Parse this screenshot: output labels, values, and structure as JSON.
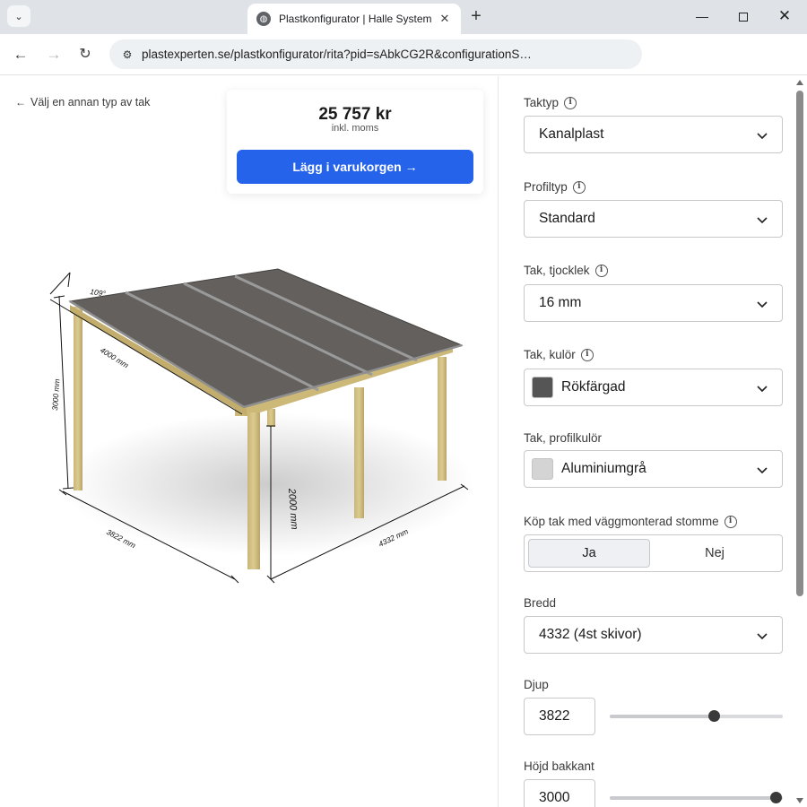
{
  "browser": {
    "tab_title": "Plastkonfigurator | Halle System",
    "url": "plastexperten.se/plastkonfigurator/rita?pid=sAbkCG2R&configurationS…",
    "tab_search_icon": "chevron-down-icon",
    "favicon": "globe-icon"
  },
  "page": {
    "back_link": "Välj en annan typ av tak",
    "price": "25 757 kr",
    "price_sub": "inkl. moms",
    "cart_button": "Lägg i varukorgen",
    "accent_color": "#2563eb"
  },
  "drawing": {
    "angle": "109°",
    "length_top": "4000 mm",
    "height_back": "3000 mm",
    "height_front": "2000 mm",
    "depth": "3822 mm",
    "width": "4332 mm"
  },
  "config": {
    "taktyp": {
      "label": "Taktyp",
      "value": "Kanalplast"
    },
    "profiltyp": {
      "label": "Profiltyp",
      "value": "Standard"
    },
    "tjocklek": {
      "label": "Tak, tjocklek",
      "value": "16 mm"
    },
    "kulor": {
      "label": "Tak, kulör",
      "value": "Rökfärgad",
      "swatch": "#555555"
    },
    "profilkulor": {
      "label": "Tak, profilkulör",
      "value": "Aluminiumgrå",
      "swatch": "#d4d4d4"
    },
    "stomme": {
      "label": "Köp tak med väggmonterad stomme",
      "options": [
        "Ja",
        "Nej"
      ],
      "selected": "Ja"
    },
    "bredd": {
      "label": "Bredd",
      "value": "4332 (4st skivor)"
    },
    "djup": {
      "label": "Djup",
      "value": "3822",
      "slider_fraction": 0.6
    },
    "hojd": {
      "label": "Höjd bakkant",
      "value": "3000",
      "slider_fraction": 0.96
    }
  }
}
